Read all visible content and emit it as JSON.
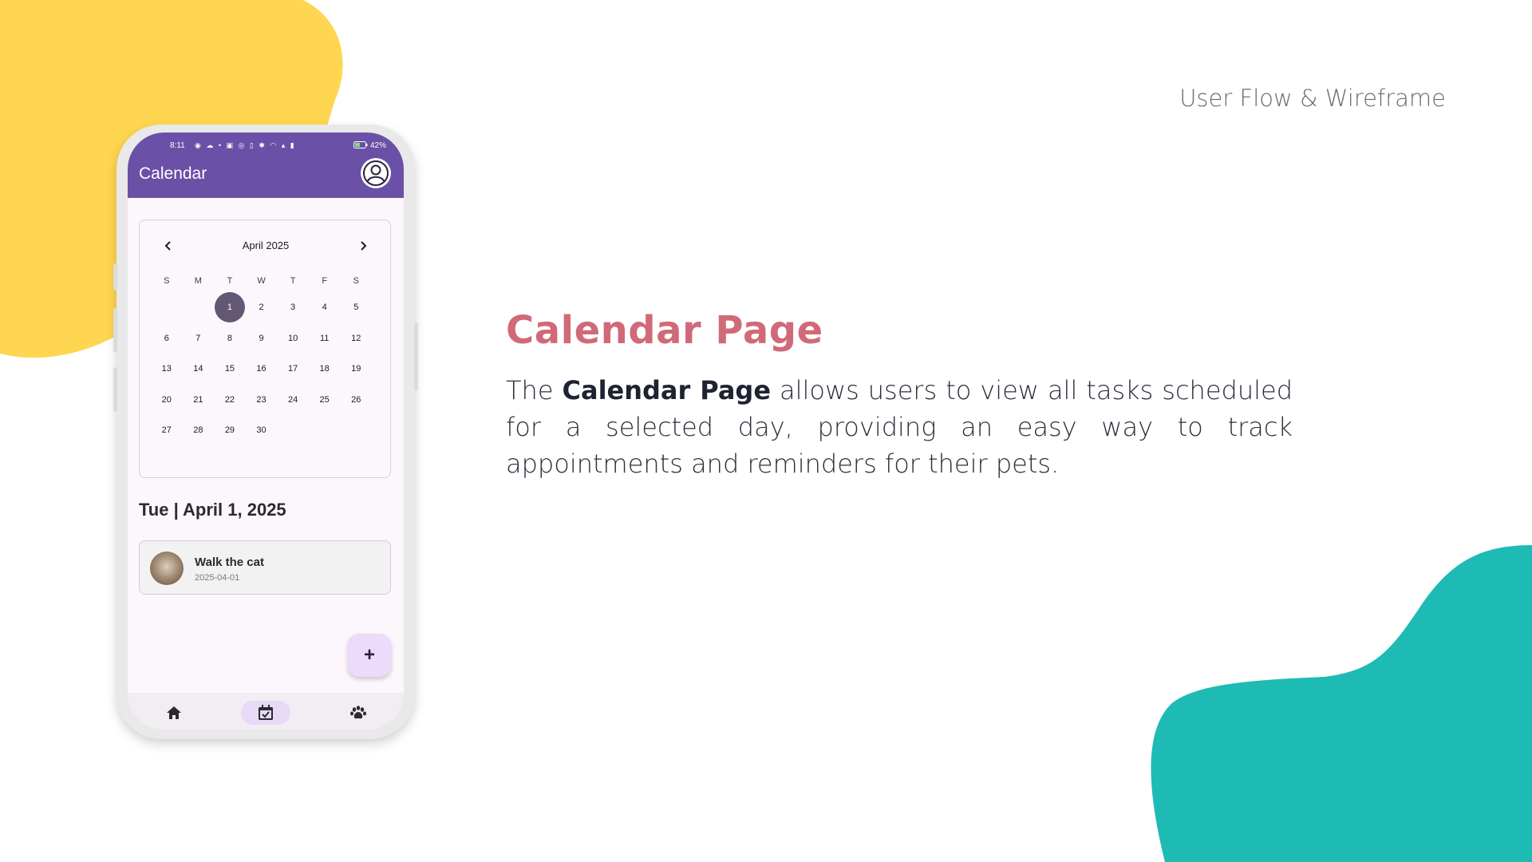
{
  "slide": {
    "header_label": "User Flow & Wireframe",
    "heading": "Calendar Page",
    "description_prefix": "The ",
    "description_bold": "Calendar Page",
    "description_suffix": " allows users to view all tasks scheduled for a selected day, providing an easy way to track appointments and reminders for their pets.",
    "colors": {
      "yellow_blob": "#ffd64f",
      "teal_blob": "#1ebbb4",
      "heading": "#d06a78"
    }
  },
  "phone": {
    "status_bar": {
      "time": "8:11",
      "battery": "42%"
    },
    "app_bar": {
      "title": "Calendar",
      "profile_icon": "user-circle-icon",
      "color": "#6a50a6"
    },
    "calendar": {
      "month_label": "April 2025",
      "weekdays": [
        "S",
        "M",
        "T",
        "W",
        "T",
        "F",
        "S"
      ],
      "weeks": [
        [
          "",
          "",
          "1",
          "2",
          "3",
          "4",
          "5"
        ],
        [
          "6",
          "7",
          "8",
          "9",
          "10",
          "11",
          "12"
        ],
        [
          "13",
          "14",
          "15",
          "16",
          "17",
          "18",
          "19"
        ],
        [
          "20",
          "21",
          "22",
          "23",
          "24",
          "25",
          "26"
        ],
        [
          "27",
          "28",
          "29",
          "30",
          "",
          "",
          ""
        ]
      ],
      "selected_day": "1"
    },
    "selected_date_heading": "Tue | April 1, 2025",
    "tasks": [
      {
        "title": "Walk the cat",
        "date": "2025-04-01"
      }
    ],
    "fab_label": "+",
    "bottom_nav": [
      {
        "icon": "home-icon",
        "active": false
      },
      {
        "icon": "calendar-check-icon",
        "active": true
      },
      {
        "icon": "paw-icon",
        "active": false
      }
    ]
  }
}
